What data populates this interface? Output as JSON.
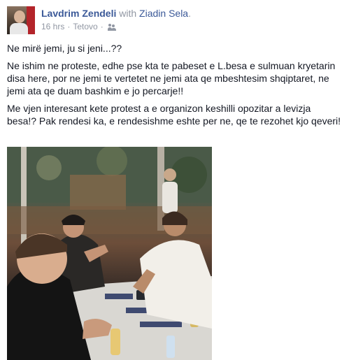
{
  "post": {
    "author": "Lavdrim Zendeli",
    "with_text": "with",
    "tagged": "Ziadin Sela",
    "period": ".",
    "time": "16 hrs",
    "separator": "·",
    "location": "Tetovo",
    "audience_icon": "friends-icon",
    "paragraphs": [
      "Ne mirë jemi, ju si jeni...??",
      "Ne ishim ne proteste, edhe pse kta te pabeset e L.besa e sulmuan kryetarin disa here, por ne jemi te vertetet ne jemi ata qe mbeshtesim shqiptaret, ne jemi ata qe duam bashkim e jo percarje!!",
      "Me vjen interesant kete protest a e organizon keshilli opozitar a levizja besa!? Pak rendesi ka, e rendesishme eshte per ne, qe te rezohet kjo qeveri!"
    ]
  }
}
